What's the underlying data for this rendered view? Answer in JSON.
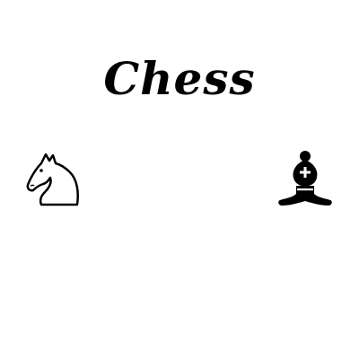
{
  "title": "Chess",
  "pieces": [
    {
      "icon": "white-knight-icon",
      "color": "#000000"
    },
    {
      "icon": "black-bishop-icon",
      "color": "#000000"
    }
  ]
}
